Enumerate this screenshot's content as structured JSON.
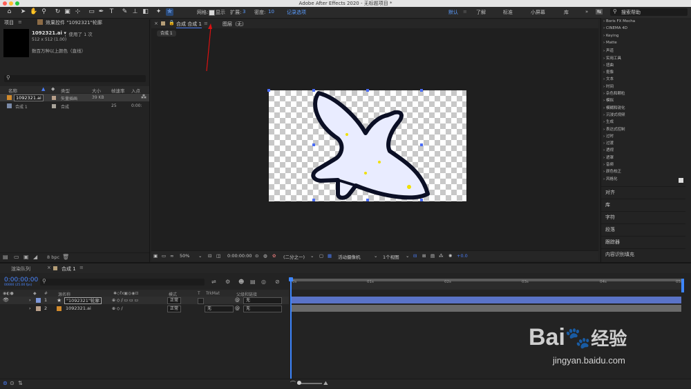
{
  "app": {
    "title": "Adobe After Effects 2020 - 无标题项目 *"
  },
  "toolbar": {
    "grid_label": "网格:",
    "show_label": "显示",
    "expand_label": "扩展:",
    "expand_value": "3",
    "density_label": "密度:",
    "density_value": "10",
    "record_options": "记录选项",
    "workspaces": [
      "默认",
      "了解",
      "标准",
      "小屏幕",
      "库"
    ],
    "search_placeholder": "搜索帮助"
  },
  "project_panel": {
    "tab": "项目",
    "effects_tab": "效果控件 \"1092321\"轮廓",
    "asset_name": "1092321.ai ▾",
    "asset_used": "，使用了 1 次",
    "asset_dims": "512 x 512 (1.00)",
    "asset_color": "数百万种以上颜色（直线）",
    "columns": [
      "名称",
      "类型",
      "大小",
      "帧速率",
      "入点"
    ],
    "items": [
      {
        "name": "1092321.ai",
        "type": "矢量插画",
        "size": "39 KB",
        "fps": "",
        "in": ""
      },
      {
        "name": "合成 1",
        "type": "合成",
        "size": "",
        "fps": "25",
        "in": "0:00:"
      }
    ],
    "bpc": "8 bpc"
  },
  "comp_panel": {
    "tab_label": "合成 合成 1",
    "layer_label": "图层（无）",
    "crumb": "合成 1",
    "zoom": "50%",
    "time": "0:00:00:00",
    "resolution": "(二分之一)",
    "camera": "活动摄像机",
    "views": "1个视图",
    "exposure": "+0.0"
  },
  "effects_list": [
    "Boris FX Mocha",
    "CINEMA 4D",
    "Keying",
    "Matte",
    "声道",
    "实用工具",
    "扭曲",
    "抠像",
    "文本",
    "时间",
    "杂色和颗粒",
    "模拟",
    "模糊和锐化",
    "沉浸式视频",
    "生成",
    "表达式控制",
    "过时",
    "过渡",
    "透视",
    "遮罩",
    "音频",
    "颜色校正",
    "风格化"
  ],
  "right_panels": [
    "对齐",
    "库",
    "字符",
    "段落",
    "跟踪器",
    "内容识别填充"
  ],
  "timeline": {
    "render_queue_tab": "渲染队列",
    "comp_tab": "合成 1",
    "timecode": "0:00:00:00",
    "frame_info": "00000 (25.00 fps)",
    "col_hash": "#",
    "col_source": "源名称",
    "col_mode": "模式",
    "col_t": "T",
    "col_trkmat": "TrkMat",
    "col_parent": "父级和链接",
    "layers": [
      {
        "num": "1",
        "name": "\"1092321\"轮廓",
        "mode": "正常",
        "trkmat": "",
        "parent": "无"
      },
      {
        "num": "2",
        "name": "1092321.ai",
        "mode": "正常",
        "trkmat": "无",
        "parent": "无"
      }
    ],
    "ruler": [
      "0s",
      "01s",
      "02s",
      "03s",
      "04s",
      "05s"
    ]
  },
  "watermark": {
    "text_a": "Bai",
    "text_b": "经验",
    "url": "jingyan.baidu.com"
  },
  "colors": {
    "accent_blue": "#4a7cf5",
    "layer1_bar": "#5a73c7",
    "layer2_bar": "#6b6b6b",
    "playhead": "#3d86ff"
  }
}
